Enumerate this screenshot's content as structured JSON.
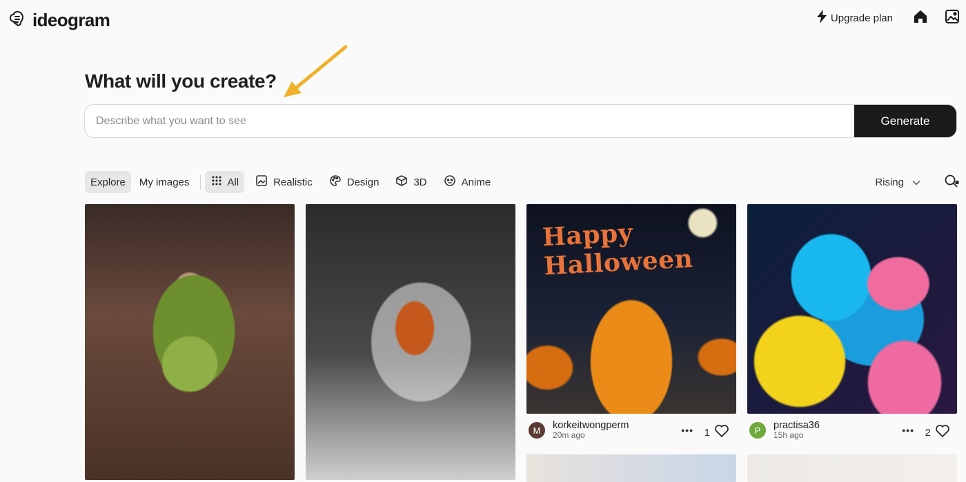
{
  "header": {
    "logo_text": "ideogram",
    "upgrade_label": "Upgrade plan"
  },
  "main": {
    "heading": "What will you create?",
    "prompt_placeholder": "Describe what you want to see",
    "generate_label": "Generate"
  },
  "filters": {
    "tabs": [
      {
        "label": "Explore",
        "active": true
      },
      {
        "label": "My images",
        "active": false
      }
    ],
    "categories": [
      {
        "label": "All",
        "icon": "grid-icon",
        "active": true
      },
      {
        "label": "Realistic",
        "icon": "photo-icon",
        "active": false
      },
      {
        "label": "Design",
        "icon": "palette-icon",
        "active": false
      },
      {
        "label": "3D",
        "icon": "cube-icon",
        "active": false
      },
      {
        "label": "Anime",
        "icon": "face-icon",
        "active": false
      }
    ],
    "sort": "Rising"
  },
  "gallery": {
    "card3_text": "Happy Halloween",
    "posts": [
      {
        "avatar_letter": "M",
        "avatar_color": "#5b3a34",
        "username": "korkeitwongperm",
        "time": "20m ago",
        "likes": "1"
      },
      {
        "avatar_letter": "P",
        "avatar_color": "#6fa83c",
        "username": "practisa36",
        "time": "15h ago",
        "likes": "2"
      }
    ]
  },
  "annotation": {
    "arrow_color": "#f0b12a"
  }
}
